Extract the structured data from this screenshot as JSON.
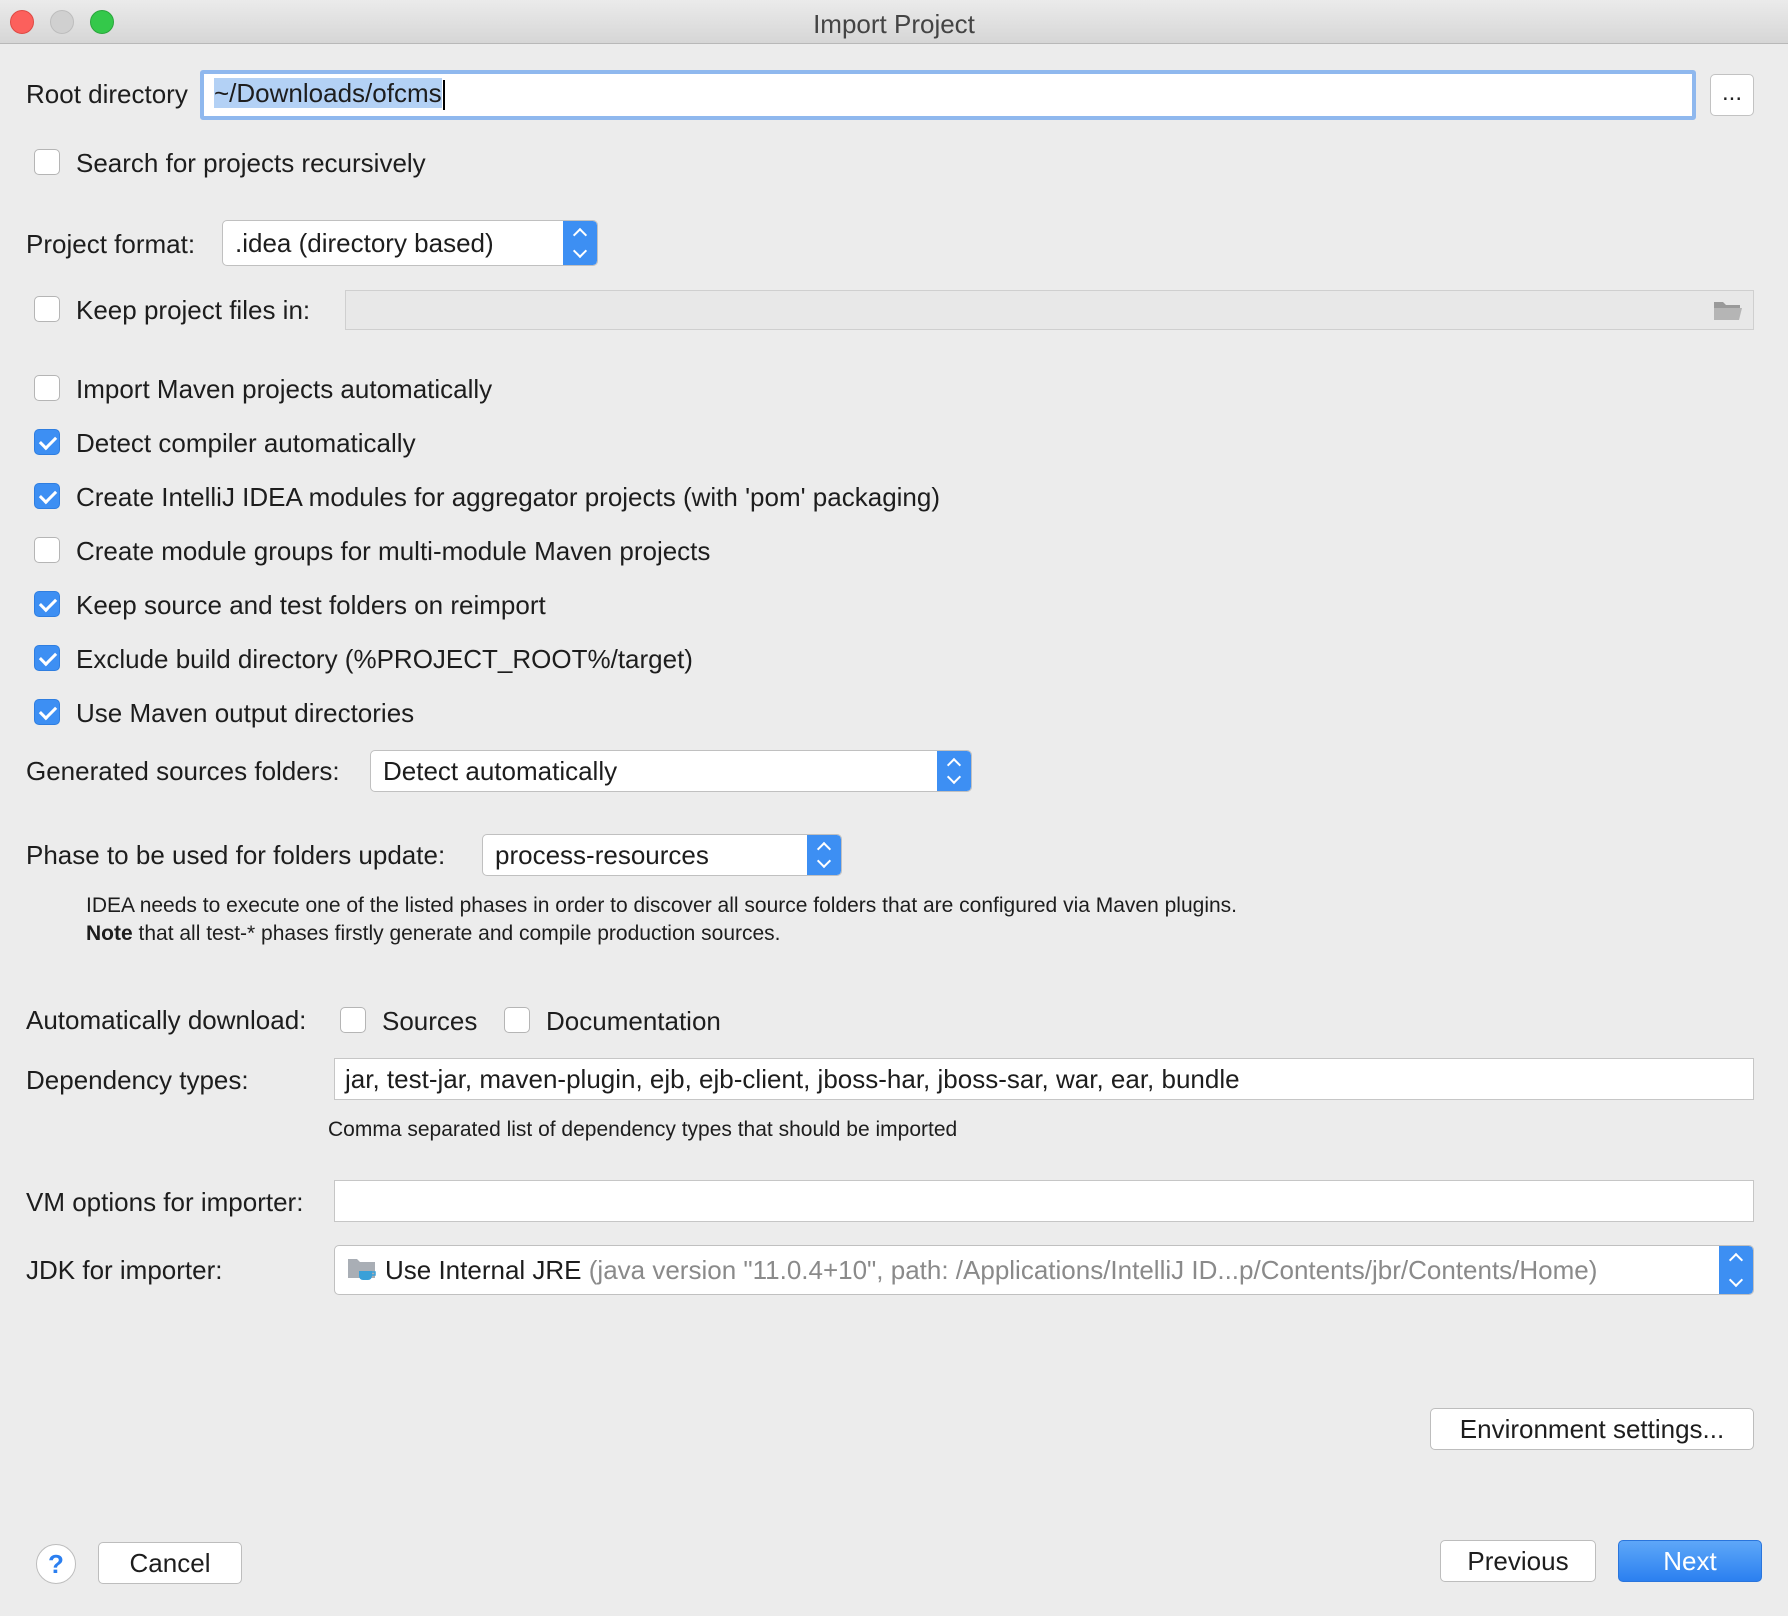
{
  "window": {
    "title": "Import Project"
  },
  "root_directory": {
    "label": "Root directory",
    "value": "~/Downloads/ofcms",
    "browse_label": "..."
  },
  "search_recursively": {
    "label": "Search for projects recursively",
    "checked": false
  },
  "project_format": {
    "label": "Project format:",
    "value": ".idea (directory based)"
  },
  "keep_project_files": {
    "label": "Keep project files in:",
    "checked": false,
    "value": ""
  },
  "options": [
    {
      "label": "Import Maven projects automatically",
      "checked": false
    },
    {
      "label": "Detect compiler automatically",
      "checked": true
    },
    {
      "label": "Create IntelliJ IDEA modules for aggregator projects (with 'pom' packaging)",
      "checked": true
    },
    {
      "label": "Create module groups for multi-module Maven projects",
      "checked": false
    },
    {
      "label": "Keep source and test folders on reimport",
      "checked": true
    },
    {
      "label": "Exclude build directory (%PROJECT_ROOT%/target)",
      "checked": true
    },
    {
      "label": "Use Maven output directories",
      "checked": true
    }
  ],
  "generated_sources": {
    "label": "Generated sources folders:",
    "value": "Detect automatically"
  },
  "phase": {
    "label": "Phase to be used for folders update:",
    "value": "process-resources",
    "hint_line1": "IDEA needs to execute one of the listed phases in order to discover all source folders that are configured via Maven plugins.",
    "hint_note_bold": "Note",
    "hint_line2": " that all test-* phases firstly generate and compile production sources."
  },
  "auto_download": {
    "label": "Automatically download:",
    "sources_label": "Sources",
    "sources_checked": false,
    "docs_label": "Documentation",
    "docs_checked": false
  },
  "dependency_types": {
    "label": "Dependency types:",
    "value": "jar, test-jar, maven-plugin, ejb, ejb-client, jboss-har, jboss-sar, war, ear, bundle",
    "hint": "Comma separated list of dependency types that should be imported"
  },
  "vm_options": {
    "label": "VM options for importer:",
    "value": ""
  },
  "jdk": {
    "label": "JDK for importer:",
    "value_main": "Use Internal JRE",
    "value_detail": " (java version \"11.0.4+10\", path: /Applications/IntelliJ ID...p/Contents/jbr/Contents/Home)",
    "icon": "jdk-folder-icon"
  },
  "buttons": {
    "environment": "Environment settings...",
    "help": "?",
    "cancel": "Cancel",
    "previous": "Previous",
    "next": "Next"
  },
  "colors": {
    "accent": "#3d8ff3",
    "focus_ring": "#8fb8ee",
    "selection": "#b3d1f5"
  }
}
